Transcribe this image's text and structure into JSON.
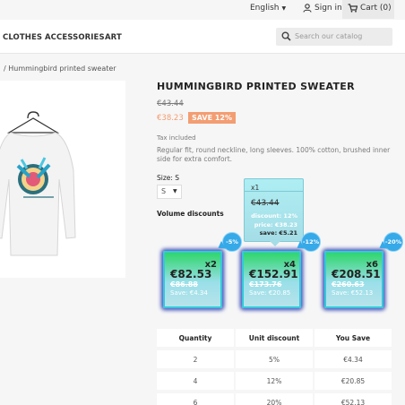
{
  "topbar": {
    "language": "English",
    "signin": "Sign in",
    "cart": "Cart (0)"
  },
  "nav": {
    "items": [
      "CLOTHES",
      "ACCESSORIES",
      "ART"
    ]
  },
  "search": {
    "placeholder": "Search our catalog"
  },
  "breadcrumb": {
    "text": "/ Hummingbird printed sweater"
  },
  "product": {
    "title": "HUMMINGBIRD PRINTED SWEATER",
    "old_price": "€43.44",
    "price": "€38.23",
    "save_badge": "SAVE 12%",
    "tax": "Tax included",
    "description": "Regular fit, round neckline, long sleeves. 100% cotton, brushed inner side for extra comfort.",
    "size_label": "Size: S",
    "size_value": "S",
    "volume_discounts_label": "Volume discounts"
  },
  "tooltip": {
    "multiplier": "x1",
    "old_price": "€43.44",
    "discount": "discount: 12%",
    "price": "price: €38.23",
    "save": "save: €5.21"
  },
  "cards": [
    {
      "multiplier": "x2",
      "price": "€82.53",
      "old_price": "€86.88",
      "save": "Save: €4.34",
      "badge": "-5%"
    },
    {
      "multiplier": "x4",
      "price": "€152.91",
      "old_price": "€173.76",
      "save": "Save: €20.85",
      "badge": "-12%"
    },
    {
      "multiplier": "x6",
      "price": "€208.51",
      "old_price": "€260.63",
      "save": "Save: €52.13",
      "badge": "-20%"
    }
  ],
  "table": {
    "headers": [
      "Quantity",
      "Unit discount",
      "You Save"
    ],
    "rows": [
      [
        "2",
        "5%",
        "€4.34"
      ],
      [
        "4",
        "12%",
        "€20.85"
      ],
      [
        "6",
        "20%",
        "€52.13"
      ]
    ]
  }
}
